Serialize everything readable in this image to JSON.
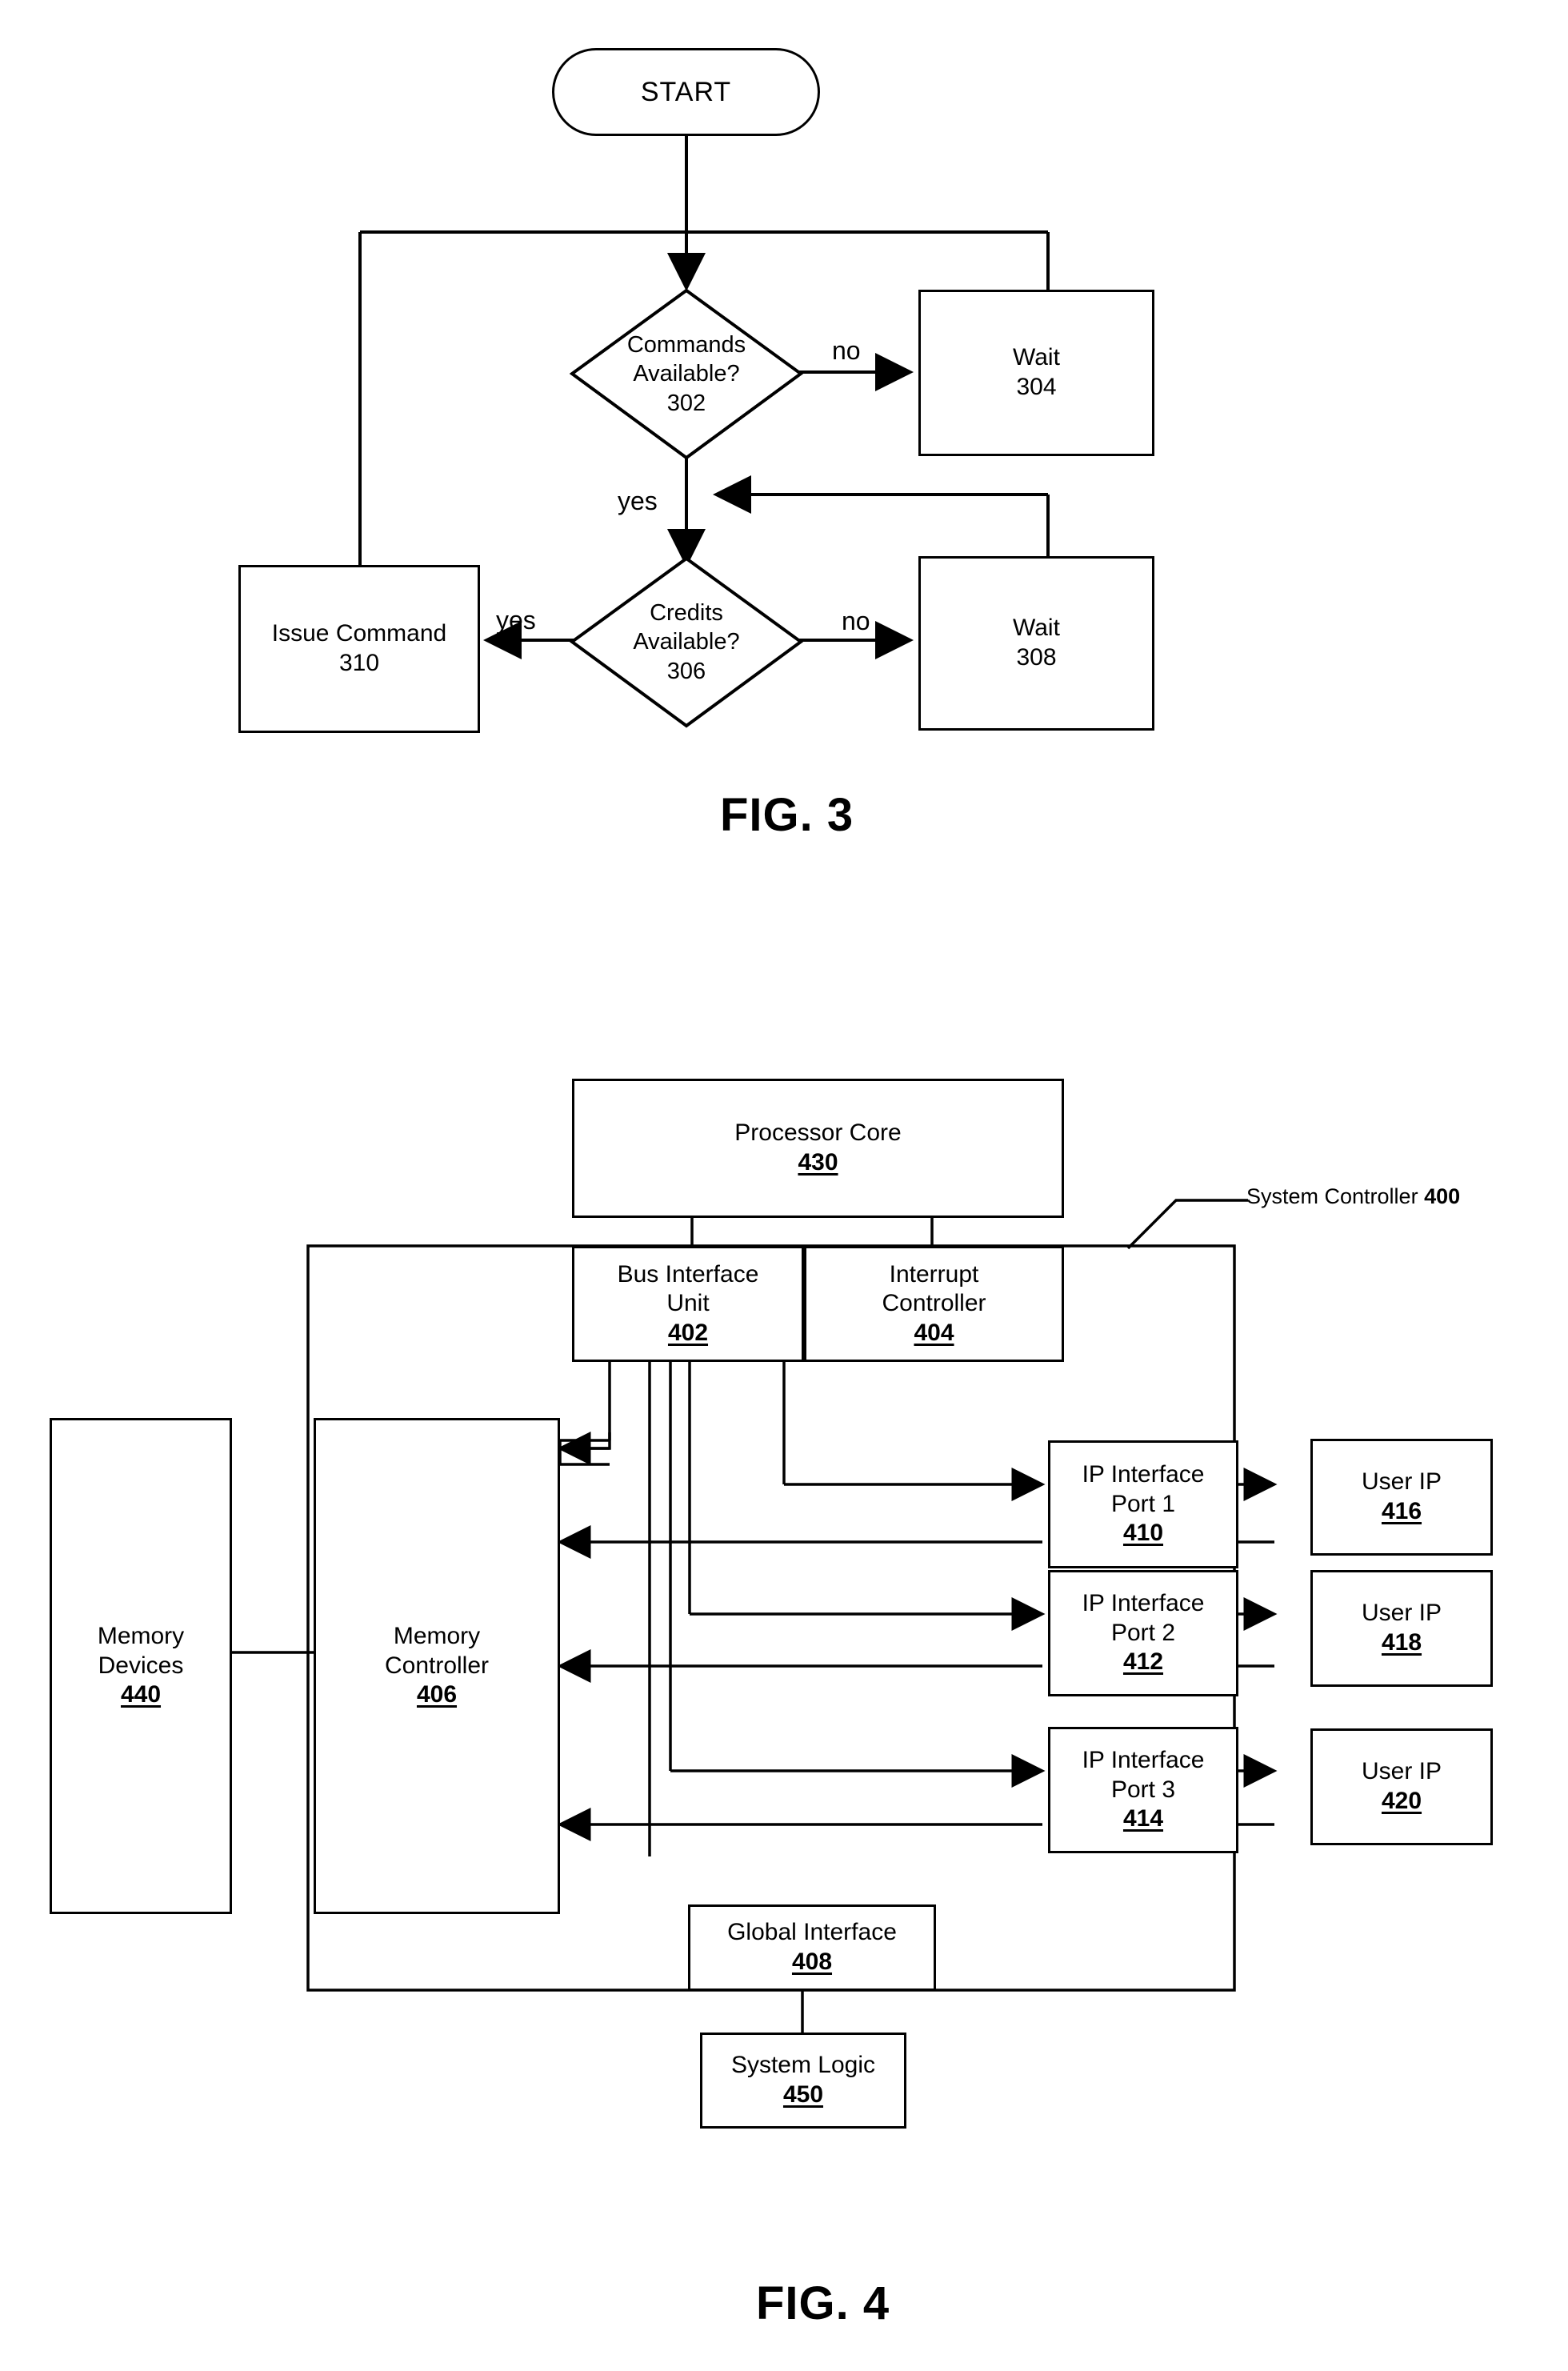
{
  "figures": [
    {
      "caption": "FIG. 3",
      "type": "flowchart",
      "nodes": {
        "start": {
          "label": "START"
        },
        "commands_available": {
          "line1": "Commands",
          "line2": "Available?",
          "ref": "302"
        },
        "wait_304": {
          "line1": "Wait",
          "ref": "304"
        },
        "credits_available": {
          "line1": "Credits",
          "line2": "Available?",
          "ref": "306"
        },
        "wait_308": {
          "line1": "Wait",
          "ref": "308"
        },
        "issue_command": {
          "line1": "Issue Command",
          "ref": "310"
        }
      },
      "edge_labels": {
        "commands_no": "no",
        "commands_yes": "yes",
        "credits_no": "no",
        "credits_yes": "yes"
      }
    },
    {
      "caption": "FIG. 4",
      "type": "block-diagram",
      "callout": {
        "text": "System Controller ",
        "ref": "400"
      },
      "nodes": {
        "processor_core": {
          "line1": "Processor Core",
          "ref": "430"
        },
        "bus_interface_unit": {
          "line1": "Bus Interface",
          "line2": "Unit",
          "ref": "402"
        },
        "interrupt_controller": {
          "line1": "Interrupt",
          "line2": "Controller",
          "ref": "404"
        },
        "memory_devices": {
          "line1": "Memory",
          "line2": "Devices",
          "ref": "440"
        },
        "memory_controller": {
          "line1": "Memory",
          "line2": "Controller",
          "ref": "406"
        },
        "ip_interface_port_1": {
          "line1": "IP Interface",
          "line2": "Port 1",
          "ref": "410"
        },
        "ip_interface_port_2": {
          "line1": "IP Interface",
          "line2": "Port 2",
          "ref": "412"
        },
        "ip_interface_port_3": {
          "line1": "IP Interface",
          "line2": "Port 3",
          "ref": "414"
        },
        "user_ip_416": {
          "line1": "User IP",
          "ref": "416"
        },
        "user_ip_418": {
          "line1": "User IP",
          "ref": "418"
        },
        "user_ip_420": {
          "line1": "User IP",
          "ref": "420"
        },
        "global_interface": {
          "line1": "Global Interface",
          "ref": "408"
        },
        "system_logic": {
          "line1": "System Logic",
          "ref": "450"
        }
      }
    }
  ],
  "colors": {
    "ink": "#000000",
    "paper": "#ffffff"
  }
}
